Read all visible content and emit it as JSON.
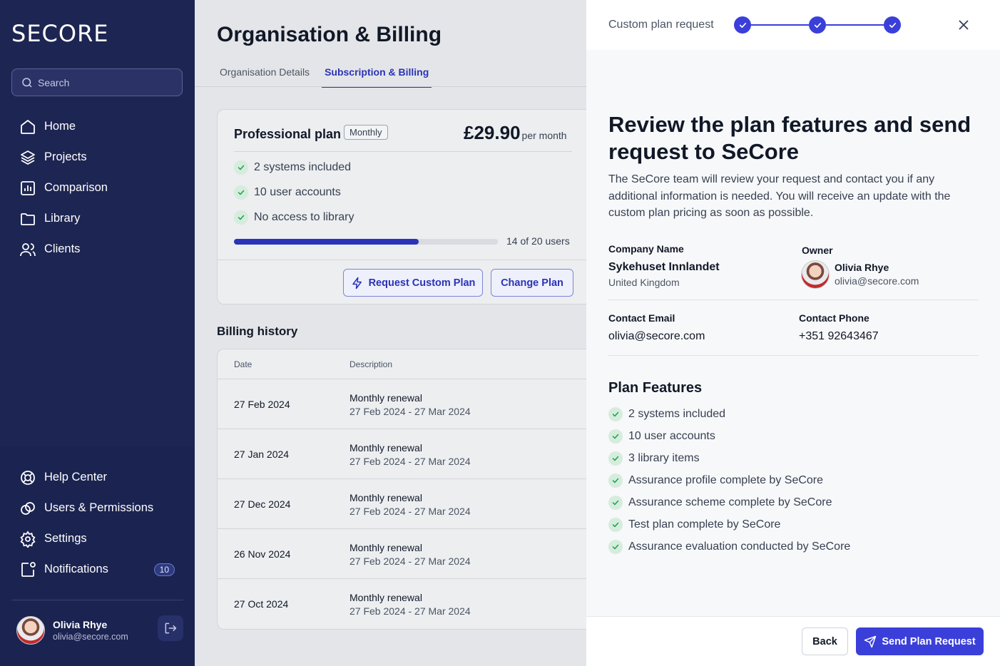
{
  "app": {
    "logo_text": "SECORE"
  },
  "sidebar": {
    "search_placeholder": "Search",
    "items": [
      {
        "label": "Home",
        "icon": "home-icon"
      },
      {
        "label": "Projects",
        "icon": "layers-icon"
      },
      {
        "label": "Comparison",
        "icon": "chart-icon"
      },
      {
        "label": "Library",
        "icon": "folder-icon"
      },
      {
        "label": "Clients",
        "icon": "users-icon"
      }
    ],
    "bottom_items": [
      {
        "label": "Help Center",
        "icon": "lifebuoy-icon"
      },
      {
        "label": "Users & Permissions",
        "icon": "permissions-icon"
      },
      {
        "label": "Settings",
        "icon": "gear-icon"
      },
      {
        "label": "Notifications",
        "icon": "bell-icon",
        "badge": "10"
      }
    ],
    "user": {
      "name": "Olivia Rhye",
      "email": "olivia@secore.com"
    }
  },
  "main": {
    "title": "Organisation & Billing",
    "tabs": [
      {
        "label": "Organisation Details",
        "active": false
      },
      {
        "label": "Subscription & Billing",
        "active": true
      }
    ],
    "plan": {
      "name": "Professional plan",
      "tag": "Monthly",
      "price": "£29.90",
      "period": "per month",
      "features": [
        "2 systems included",
        "10 user accounts",
        "No access to library"
      ],
      "usage_fraction": 0.7,
      "usage_label": "14 of 20 users",
      "request_button": "Request Custom Plan",
      "change_button": "Change Plan"
    },
    "billing": {
      "title": "Billing history",
      "columns": [
        "Date",
        "Description"
      ],
      "rows": [
        {
          "date": "27 Feb 2024",
          "desc": "Monthly renewal",
          "range": "27 Feb 2024 - 27 Mar 2024"
        },
        {
          "date": "27 Jan 2024",
          "desc": "Monthly renewal",
          "range": "27 Feb 2024 - 27 Mar 2024"
        },
        {
          "date": "27 Dec 2024",
          "desc": "Monthly renewal",
          "range": "27 Feb 2024 - 27 Mar 2024"
        },
        {
          "date": "26 Nov 2024",
          "desc": "Monthly renewal",
          "range": "27 Feb 2024 - 27 Mar 2024"
        },
        {
          "date": "27 Oct 2024",
          "desc": "Monthly renewal",
          "range": "27 Feb 2024 - 27 Mar 2024"
        }
      ]
    }
  },
  "panel": {
    "step_label": "Custom plan request",
    "heading": "Review the plan features and send request to SeCore",
    "paragraph": "The SeCore team will review your request and contact you if any additional information is needed. You will receive an update with the custom plan pricing as soon as possible.",
    "company_label": "Company Name",
    "company_name": "Sykehuset Innlandet",
    "company_country": "United Kingdom",
    "owner_label": "Owner",
    "owner_name": "Olivia Rhye",
    "owner_email": "olivia@secore.com",
    "email_label": "Contact Email",
    "email_value": "olivia@secore.com",
    "phone_label": "Contact Phone",
    "phone_value": "+351 92643467",
    "features_title": "Plan Features",
    "features": [
      "2 systems included",
      "10 user accounts",
      "3 library items",
      "Assurance profile complete by SeCore",
      "Assurance scheme complete by SeCore",
      "Test plan complete by SeCore",
      "Assurance evaluation conducted by SeCore"
    ],
    "back_button": "Back",
    "send_button": "Send Plan Request"
  },
  "colors": {
    "sidebar": "#1d2552",
    "accent": "#3b3fd9",
    "check": "#16a34a"
  }
}
